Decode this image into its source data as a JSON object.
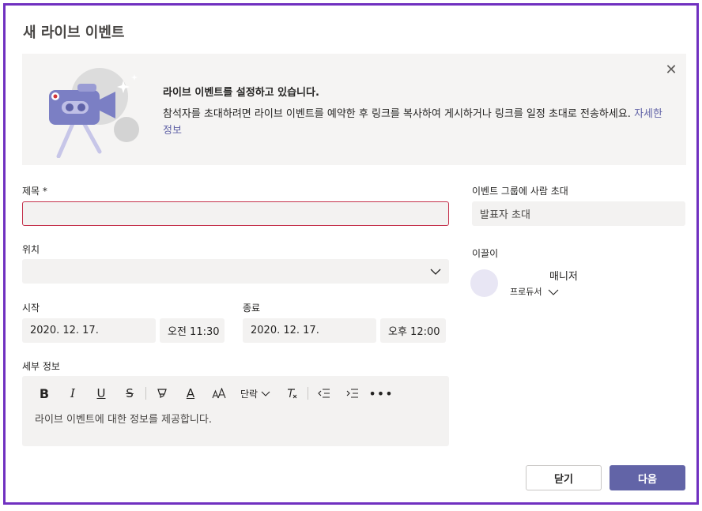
{
  "dialog": {
    "title": "새 라이브 이벤트"
  },
  "banner": {
    "heading": "라이브 이벤트를 설정하고 있습니다.",
    "text": "참석자를 초대하려면 라이브 이벤트를 예약한 후 링크를 복사하여 게시하거나 링크를 일정 초대로 전송하세요.",
    "link": "자세한 정보",
    "close_icon": "close-icon"
  },
  "form": {
    "title_label": "제목 *",
    "title_value": "",
    "location_label": "위치",
    "location_value": "",
    "start_label": "시작",
    "start_date": "2020. 12. 17.",
    "start_time": "오전 11:30",
    "end_label": "종료",
    "end_date": "2020. 12. 17.",
    "end_time": "오후 12:00",
    "details_label": "세부 정보",
    "details_placeholder": "라이브 이벤트에 대한 정보를 제공합니다."
  },
  "toolbar": {
    "bold": "B",
    "italic": "I",
    "underline": "U",
    "strike": "S",
    "font_size": "A",
    "paragraph": "단락"
  },
  "people": {
    "invite_label": "이벤트 그룹에 사람 초대",
    "invite_placeholder": "발표자 초대",
    "organizer_label": "이끌이",
    "organizer_name": "매니저",
    "organizer_role": "프로듀서"
  },
  "buttons": {
    "close": "닫기",
    "next": "다음"
  },
  "colors": {
    "accent": "#6264a7",
    "error_border": "#c4314b",
    "frame": "#7030c0"
  }
}
